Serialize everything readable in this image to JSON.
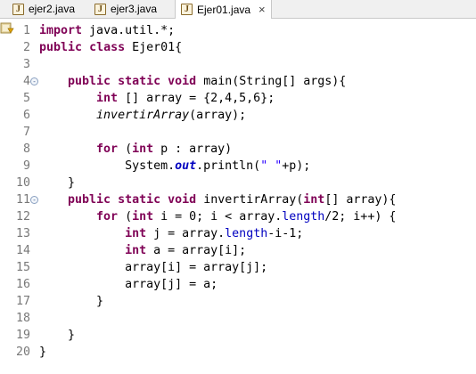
{
  "tabs": [
    {
      "label": "ejer2.java",
      "icon": "java-file-icon",
      "active": false
    },
    {
      "label": "ejer3.java",
      "icon": "java-file-icon",
      "active": false
    },
    {
      "label": "Ejer01.java",
      "icon": "java-file-icon",
      "active": true,
      "close": "×"
    }
  ],
  "icon_glyph": "J",
  "fold_glyph": "⊖",
  "lines": [
    {
      "n": "1",
      "t": "import java.util.*;"
    },
    {
      "n": "2",
      "t": "public class Ejer01{"
    },
    {
      "n": "3",
      "t": ""
    },
    {
      "n": "4",
      "t": "    public static void main(String[] args){"
    },
    {
      "n": "5",
      "t": "        int [] array = {2,4,5,6};"
    },
    {
      "n": "6",
      "t": "        invertirArray(array);"
    },
    {
      "n": "7",
      "t": ""
    },
    {
      "n": "8",
      "t": "        for (int p : array)"
    },
    {
      "n": "9",
      "t": "            System.out.println(\" \"+p);"
    },
    {
      "n": "10",
      "t": "    }"
    },
    {
      "n": "11",
      "t": "    public static void invertirArray(int[] array){"
    },
    {
      "n": "12",
      "t": "        for (int i = 0; i < array.length/2; i++) {"
    },
    {
      "n": "13",
      "t": "            int j = array.length-i-1;"
    },
    {
      "n": "14",
      "t": "            int a = array[i];"
    },
    {
      "n": "15",
      "t": "            array[i] = array[j];"
    },
    {
      "n": "16",
      "t": "            array[j] = a;"
    },
    {
      "n": "17",
      "t": "        }"
    },
    {
      "n": "18",
      "t": ""
    },
    {
      "n": "19",
      "t": "    }"
    },
    {
      "n": "20",
      "t": "}"
    }
  ],
  "colors": {
    "keyword": "#7f0055",
    "string": "#2a00ff",
    "static_field": "#0000c0",
    "line_number": "#787878"
  }
}
